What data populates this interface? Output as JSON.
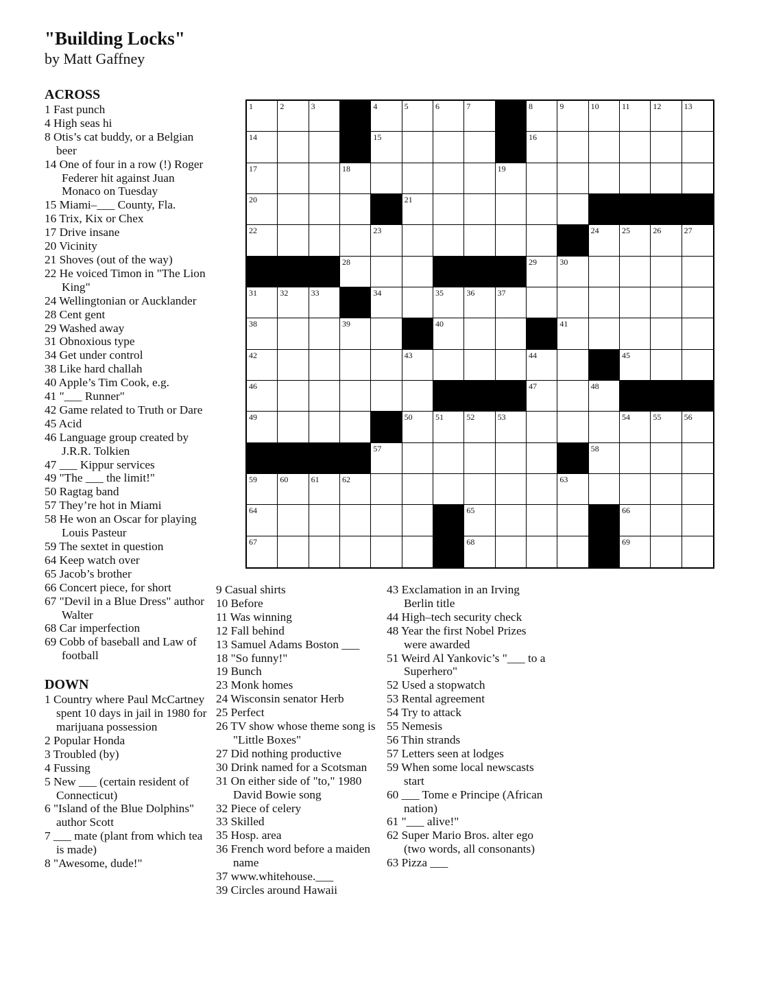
{
  "puzzle": {
    "title": "\"Building Locks\"",
    "byline": "by Matt Gaffney"
  },
  "grid": {
    "size": 15,
    "black_cells": [
      [
        0,
        3
      ],
      [
        0,
        8
      ],
      [
        1,
        3
      ],
      [
        1,
        8
      ],
      [
        3,
        4
      ],
      [
        3,
        11
      ],
      [
        3,
        12
      ],
      [
        3,
        13
      ],
      [
        3,
        14
      ],
      [
        4,
        10
      ],
      [
        5,
        0
      ],
      [
        5,
        1
      ],
      [
        5,
        2
      ],
      [
        5,
        6
      ],
      [
        5,
        7
      ],
      [
        5,
        8
      ],
      [
        6,
        3
      ],
      [
        7,
        5
      ],
      [
        7,
        9
      ],
      [
        8,
        11
      ],
      [
        9,
        6
      ],
      [
        9,
        7
      ],
      [
        9,
        8
      ],
      [
        9,
        12
      ],
      [
        9,
        13
      ],
      [
        9,
        14
      ],
      [
        10,
        4
      ],
      [
        11,
        0
      ],
      [
        11,
        1
      ],
      [
        11,
        2
      ],
      [
        11,
        3
      ],
      [
        11,
        10
      ],
      [
        13,
        6
      ],
      [
        13,
        11
      ],
      [
        14,
        6
      ],
      [
        14,
        11
      ]
    ]
  },
  "across_header": "ACROSS",
  "down_header": "DOWN",
  "across": [
    {
      "n": "1",
      "text": "Fast punch"
    },
    {
      "n": "4",
      "text": "High seas hi"
    },
    {
      "n": "8",
      "text": "Otis’s cat buddy, or a Belgian beer"
    },
    {
      "n": "14",
      "text": "One of four in a row (!) Roger Federer hit against Juan Monaco on Tuesday"
    },
    {
      "n": "15",
      "text": "Miami–___ County, Fla."
    },
    {
      "n": "16",
      "text": "Trix, Kix or Chex"
    },
    {
      "n": "17",
      "text": "Drive insane"
    },
    {
      "n": "20",
      "text": "Vicinity"
    },
    {
      "n": "21",
      "text": "Shoves (out of the way)"
    },
    {
      "n": "22",
      "text": "He voiced Timon in \"The Lion King\""
    },
    {
      "n": "24",
      "text": "Wellingtonian or Aucklander"
    },
    {
      "n": "28",
      "text": "Cent gent"
    },
    {
      "n": "29",
      "text": "Washed away"
    },
    {
      "n": "31",
      "text": "Obnoxious type"
    },
    {
      "n": "34",
      "text": "Get under control"
    },
    {
      "n": "38",
      "text": "Like hard challah"
    },
    {
      "n": "40",
      "text": "Apple’s Tim Cook, e.g."
    },
    {
      "n": "41",
      "text": "\"___ Runner\""
    },
    {
      "n": "42",
      "text": "Game related to Truth or Dare"
    },
    {
      "n": "45",
      "text": "Acid"
    },
    {
      "n": "46",
      "text": "Language group created by J.R.R. Tolkien"
    },
    {
      "n": "47",
      "text": "___ Kippur services"
    },
    {
      "n": "49",
      "text": "\"The ___ the limit!\""
    },
    {
      "n": "50",
      "text": "Ragtag band"
    },
    {
      "n": "57",
      "text": "They’re hot in Miami"
    },
    {
      "n": "58",
      "text": "He won an Oscar for playing Louis Pasteur"
    },
    {
      "n": "59",
      "text": "The sextet in question"
    },
    {
      "n": "64",
      "text": "Keep watch over"
    },
    {
      "n": "65",
      "text": "Jacob’s brother"
    },
    {
      "n": "66",
      "text": "Concert piece, for short"
    },
    {
      "n": "67",
      "text": "\"Devil in a Blue Dress\" author Walter"
    },
    {
      "n": "68",
      "text": "Car imperfection"
    },
    {
      "n": "69",
      "text": "Cobb of baseball and Law of football"
    }
  ],
  "down": [
    {
      "n": "1",
      "text": "Country where Paul McCartney spent 10 days in jail in 1980 for marijuana possession"
    },
    {
      "n": "2",
      "text": "Popular Honda"
    },
    {
      "n": "3",
      "text": "Troubled (by)"
    },
    {
      "n": "4",
      "text": "Fussing"
    },
    {
      "n": "5",
      "text": "New ___ (certain resident of Connecticut)"
    },
    {
      "n": "6",
      "text": "\"Island of the Blue Dolphins\" author Scott"
    },
    {
      "n": "7",
      "text": "___ mate (plant from which tea is made)"
    },
    {
      "n": "8",
      "text": "\"Awesome, dude!\""
    },
    {
      "n": "9",
      "text": "Casual shirts"
    },
    {
      "n": "10",
      "text": "Before"
    },
    {
      "n": "11",
      "text": "Was winning"
    },
    {
      "n": "12",
      "text": "Fall behind"
    },
    {
      "n": "13",
      "text": "Samuel Adams Boston ___"
    },
    {
      "n": "18",
      "text": "\"So funny!\""
    },
    {
      "n": "19",
      "text": "Bunch"
    },
    {
      "n": "23",
      "text": "Monk homes"
    },
    {
      "n": "24",
      "text": "Wisconsin senator Herb"
    },
    {
      "n": "25",
      "text": "Perfect"
    },
    {
      "n": "26",
      "text": "TV show whose theme song is \"Little Boxes\""
    },
    {
      "n": "27",
      "text": "Did nothing productive"
    },
    {
      "n": "30",
      "text": "Drink named for a Scotsman"
    },
    {
      "n": "31",
      "text": "On either side of \"to,\" 1980 David Bowie song"
    },
    {
      "n": "32",
      "text": "Piece of celery"
    },
    {
      "n": "33",
      "text": "Skilled"
    },
    {
      "n": "35",
      "text": "Hosp. area"
    },
    {
      "n": "36",
      "text": "French word before a maiden name"
    },
    {
      "n": "37",
      "text": "www.whitehouse.___"
    },
    {
      "n": "39",
      "text": "Circles around Hawaii"
    },
    {
      "n": "43",
      "text": "Exclamation in an Irving Berlin title"
    },
    {
      "n": "44",
      "text": "High–tech security check"
    },
    {
      "n": "48",
      "text": "Year the first Nobel Prizes were awarded"
    },
    {
      "n": "51",
      "text": "Weird Al Yankovic’s \"___ to a Superhero\""
    },
    {
      "n": "52",
      "text": "Used a stopwatch"
    },
    {
      "n": "53",
      "text": "Rental agreement"
    },
    {
      "n": "54",
      "text": "Try to attack"
    },
    {
      "n": "55",
      "text": "Nemesis"
    },
    {
      "n": "56",
      "text": "Thin strands"
    },
    {
      "n": "57",
      "text": "Letters seen at lodges"
    },
    {
      "n": "59",
      "text": "When some local newscasts start"
    },
    {
      "n": "60",
      "text": "___ Tome e Principe (African nation)"
    },
    {
      "n": "61",
      "text": "\"___ alive!\""
    },
    {
      "n": "62",
      "text": "Super Mario Bros. alter ego (two words, all consonants)"
    },
    {
      "n": "63",
      "text": "Pizza ___"
    }
  ]
}
